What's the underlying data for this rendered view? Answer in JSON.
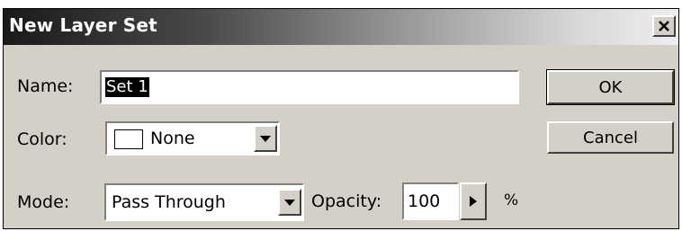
{
  "dialog": {
    "title": "New Layer Set",
    "close_icon": "close-x-icon"
  },
  "fields": {
    "name_label": "Name:",
    "name_value": "Set 1",
    "color_label": "Color:",
    "color_value": "None",
    "color_swatch": "#ffffff",
    "mode_label": "Mode:",
    "mode_value": "Pass Through",
    "opacity_label": "Opacity:",
    "opacity_value": "100",
    "opacity_unit": "%"
  },
  "buttons": {
    "ok_label": "OK",
    "cancel_label": "Cancel"
  }
}
